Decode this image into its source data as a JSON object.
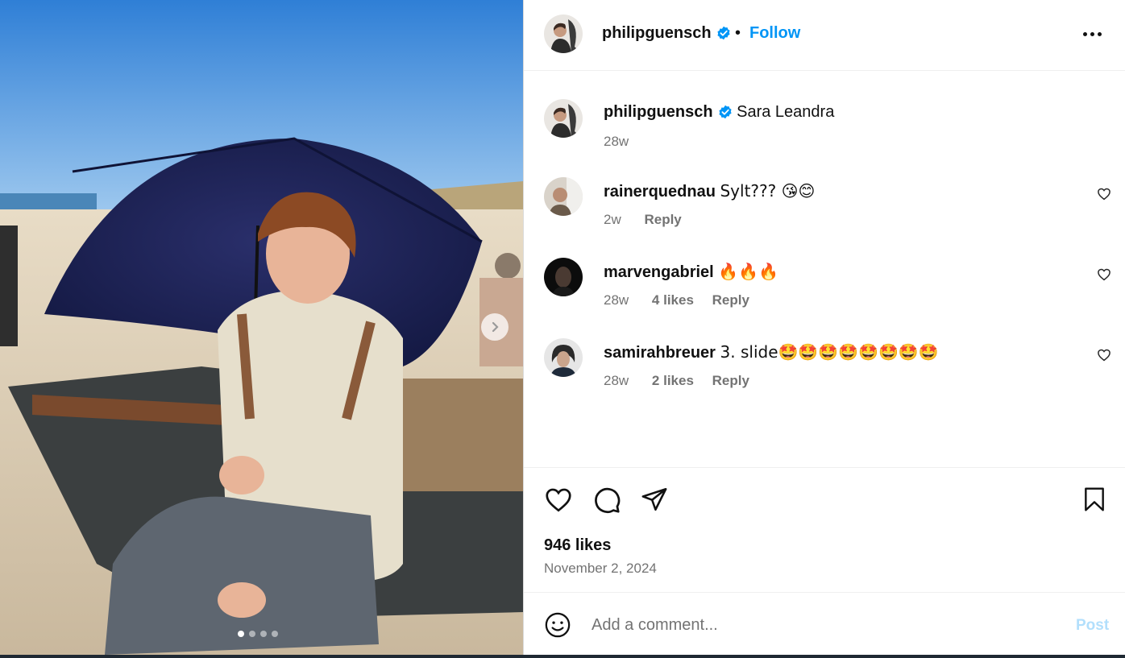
{
  "post": {
    "author": "philipguensch",
    "follow_label": "Follow",
    "separator": "•",
    "caption": {
      "author": "philipguensch",
      "text": "Sara Leandra",
      "time": "28w"
    },
    "carousel": {
      "slide_count": 4,
      "active_index": 0
    }
  },
  "comments": [
    {
      "user": "rainerquednau",
      "text": "Sylt??? 😘😊",
      "time": "2w",
      "likes": "",
      "reply_label": "Reply"
    },
    {
      "user": "marvengabriel",
      "text": "🔥🔥🔥",
      "time": "28w",
      "likes": "4 likes",
      "reply_label": "Reply"
    },
    {
      "user": "samirahbreuer",
      "text": "3. slide🤩🤩🤩🤩🤩🤩🤩🤩",
      "time": "28w",
      "likes": "2 likes",
      "reply_label": "Reply"
    }
  ],
  "stats": {
    "likes": "946 likes",
    "date": "November 2, 2024"
  },
  "composer": {
    "placeholder": "Add a comment...",
    "post_label": "Post"
  },
  "colors": {
    "accent": "#0095f6",
    "verified": "#0095f6",
    "muted": "#737373",
    "post_disabled": "#b2dffc"
  },
  "icons": [
    "verified-badge-icon",
    "more-options-icon",
    "heart-icon",
    "comment-icon",
    "share-icon",
    "bookmark-icon",
    "emoji-icon",
    "chevron-right-icon"
  ]
}
